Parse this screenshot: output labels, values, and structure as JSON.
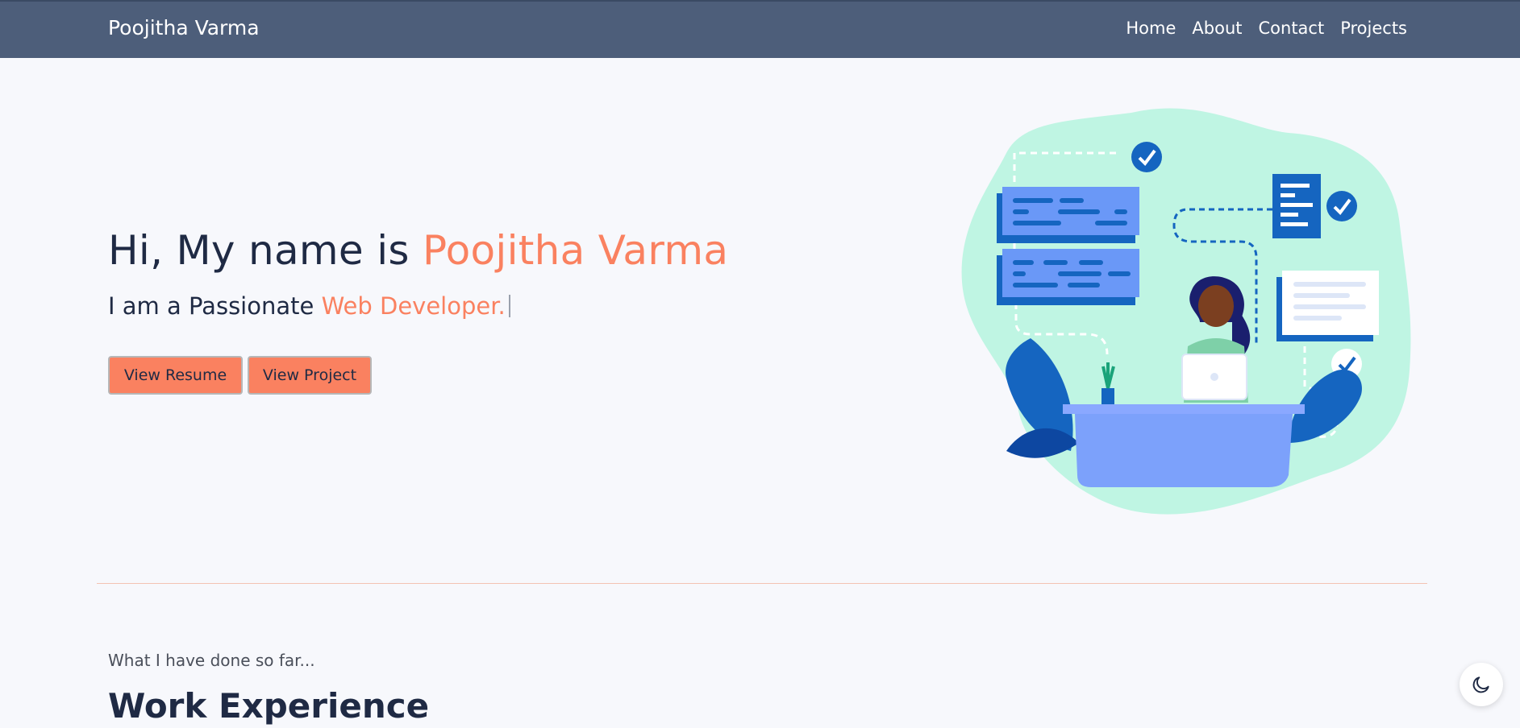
{
  "header": {
    "brand": "Poojitha Varma",
    "nav": [
      {
        "label": "Home"
      },
      {
        "label": "About"
      },
      {
        "label": "Contact"
      },
      {
        "label": "Projects"
      }
    ]
  },
  "hero": {
    "greeting": "Hi, My name is ",
    "name": "Poojitha Varma",
    "tagline_prefix": "I am a Passionate ",
    "role": "Web Developer.",
    "buttons": {
      "resume": "View Resume",
      "project": "View Project"
    }
  },
  "experience": {
    "kicker": "What I have done so far...",
    "title": "Work Experience"
  },
  "theme": {
    "accent": "#fa8160",
    "navbar": "#4d5e7a",
    "toggle_icon": "moon-icon"
  }
}
